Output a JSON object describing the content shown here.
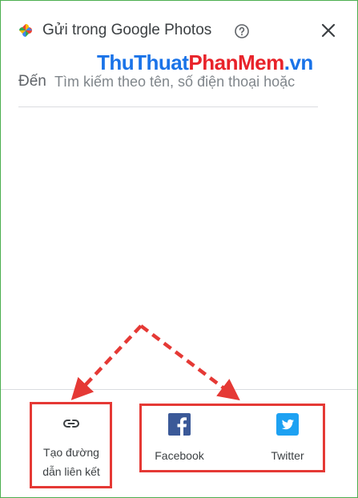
{
  "header": {
    "title": "Gửi trong Google Photos"
  },
  "watermark": {
    "part1": "ThuThuat",
    "part2": "PhanMem",
    "part3": ".vn"
  },
  "recipient": {
    "label": "Đến",
    "placeholder": "Tìm kiếm theo tên, số điện thoại hoặc"
  },
  "share_options": {
    "link": {
      "label_line1": "Tạo đường",
      "label_line2": "dẫn liên kết"
    },
    "facebook": {
      "label": "Facebook",
      "color": "#3b5998"
    },
    "twitter": {
      "label": "Twitter",
      "color": "#1da1f2"
    }
  },
  "icons": [
    "google-photos-logo",
    "help-icon",
    "close-icon",
    "link-icon",
    "facebook-icon",
    "twitter-icon"
  ],
  "annotation_color": "#e53935"
}
